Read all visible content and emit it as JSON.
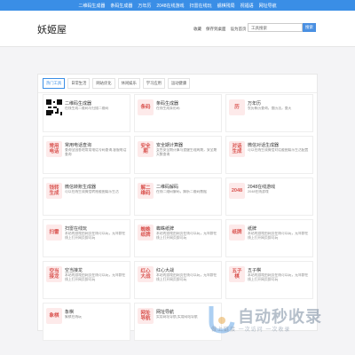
{
  "topbar": [
    "二维码生成器",
    "条码生成器",
    "万年历",
    "2048在线游戏",
    "扫雷在线玩",
    "舰棋残局",
    "祝福语",
    "网址导航"
  ],
  "header": {
    "logo": "妖姬屋",
    "links": [
      "收藏",
      "保存到桌面",
      "设为首页"
    ],
    "search_placeholder": "工具搜索",
    "search_button": "搜索"
  },
  "tabs": [
    "热门工具",
    "日常生活",
    "网站优化",
    "休闲娱乐",
    "学习应用",
    "运动健康"
  ],
  "cards": [
    {
      "icon": "qr",
      "title": "二维码生成器",
      "desc": "在线生成二维码与扫描二维码"
    },
    {
      "icon": "条码",
      "title": "条码生成器",
      "desc": "在线生成条形码"
    },
    {
      "icon": "历",
      "title": "万年历",
      "desc": "农历新历查询，查历法，查天"
    },
    {
      "icon": "常用\n电话",
      "title": "常用电话查询",
      "desc": "查询全国各地常用电话号码查询,客服电话查询"
    },
    {
      "icon": "安全\n期",
      "title": "安全期计算器",
      "desc": "女性安全期计算与提醒生理周期，安全期天数查询"
    },
    {
      "icon": "对话\n生成",
      "title": "微信对话生成器",
      "desc": "可以在线生成微信对话截图娱乐生活配置"
    },
    {
      "icon": "钱转\n生成",
      "title": "微信转账生成器",
      "desc": "可以在线生成微信转账截图娱乐生活"
    },
    {
      "icon": "解二\n维码",
      "title": "二维码解码",
      "desc": "在线二维码解码，解析二维码数据"
    },
    {
      "icon": "2048",
      "title": "2048在线游戏",
      "desc": "2048在线游戏"
    },
    {
      "icon": "扫雷",
      "title": "扫雷在线玩",
      "desc": "本站的游戏由网页在线可以玩，无年龄在线上打开网页即可玩"
    },
    {
      "icon": "蜘蛛\n纸牌",
      "title": "蜘蛛纸牌",
      "desc": "本站的游戏由网页在线可以玩，无年龄在线上打开网页即可玩"
    },
    {
      "icon": "纸牌",
      "title": "纸牌",
      "desc": "本站的游戏由网页在线可以玩，无年龄在线上打开网页即可玩"
    },
    {
      "icon": "空当\n接龙",
      "title": "空当接龙",
      "desc": "本站的游戏由网页在线可以玩，无年龄在线上打开网页即可玩"
    },
    {
      "icon": "红心\n大战",
      "title": "红心大战",
      "desc": "本站的游戏由网页在线可以玩，无年龄在线上打开网页即可玩"
    },
    {
      "icon": "五子\n棋",
      "title": "五子棋",
      "desc": "本站的游戏由网页在线可以玩，无年龄在线上打开网页即可玩"
    },
    {
      "icon": "象棋",
      "title": "象棋",
      "desc": "象棋在线玩"
    },
    {
      "icon": "网址\n导航",
      "title": "网址导航",
      "desc": "实用网址导航,实用网站导航"
    }
  ],
  "watermark": {
    "title": "自动秒收录",
    "subtitle": "做上链接 一次访问 一次收录"
  }
}
